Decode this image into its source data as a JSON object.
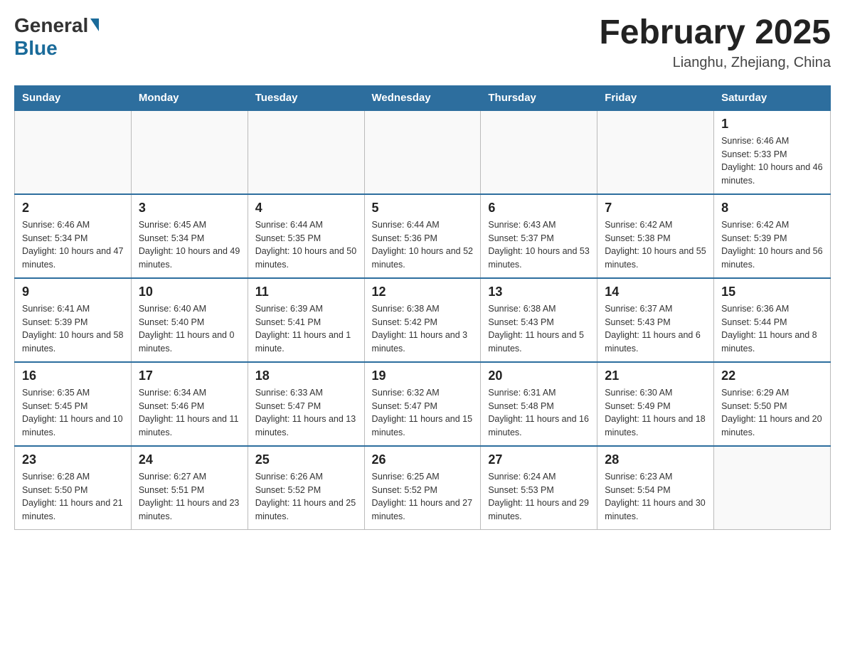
{
  "logo": {
    "general": "General",
    "blue": "Blue"
  },
  "title": "February 2025",
  "location": "Lianghu, Zhejiang, China",
  "days_of_week": [
    "Sunday",
    "Monday",
    "Tuesday",
    "Wednesday",
    "Thursday",
    "Friday",
    "Saturday"
  ],
  "weeks": [
    [
      {
        "day": "",
        "info": ""
      },
      {
        "day": "",
        "info": ""
      },
      {
        "day": "",
        "info": ""
      },
      {
        "day": "",
        "info": ""
      },
      {
        "day": "",
        "info": ""
      },
      {
        "day": "",
        "info": ""
      },
      {
        "day": "1",
        "info": "Sunrise: 6:46 AM\nSunset: 5:33 PM\nDaylight: 10 hours and 46 minutes."
      }
    ],
    [
      {
        "day": "2",
        "info": "Sunrise: 6:46 AM\nSunset: 5:34 PM\nDaylight: 10 hours and 47 minutes."
      },
      {
        "day": "3",
        "info": "Sunrise: 6:45 AM\nSunset: 5:34 PM\nDaylight: 10 hours and 49 minutes."
      },
      {
        "day": "4",
        "info": "Sunrise: 6:44 AM\nSunset: 5:35 PM\nDaylight: 10 hours and 50 minutes."
      },
      {
        "day": "5",
        "info": "Sunrise: 6:44 AM\nSunset: 5:36 PM\nDaylight: 10 hours and 52 minutes."
      },
      {
        "day": "6",
        "info": "Sunrise: 6:43 AM\nSunset: 5:37 PM\nDaylight: 10 hours and 53 minutes."
      },
      {
        "day": "7",
        "info": "Sunrise: 6:42 AM\nSunset: 5:38 PM\nDaylight: 10 hours and 55 minutes."
      },
      {
        "day": "8",
        "info": "Sunrise: 6:42 AM\nSunset: 5:39 PM\nDaylight: 10 hours and 56 minutes."
      }
    ],
    [
      {
        "day": "9",
        "info": "Sunrise: 6:41 AM\nSunset: 5:39 PM\nDaylight: 10 hours and 58 minutes."
      },
      {
        "day": "10",
        "info": "Sunrise: 6:40 AM\nSunset: 5:40 PM\nDaylight: 11 hours and 0 minutes."
      },
      {
        "day": "11",
        "info": "Sunrise: 6:39 AM\nSunset: 5:41 PM\nDaylight: 11 hours and 1 minute."
      },
      {
        "day": "12",
        "info": "Sunrise: 6:38 AM\nSunset: 5:42 PM\nDaylight: 11 hours and 3 minutes."
      },
      {
        "day": "13",
        "info": "Sunrise: 6:38 AM\nSunset: 5:43 PM\nDaylight: 11 hours and 5 minutes."
      },
      {
        "day": "14",
        "info": "Sunrise: 6:37 AM\nSunset: 5:43 PM\nDaylight: 11 hours and 6 minutes."
      },
      {
        "day": "15",
        "info": "Sunrise: 6:36 AM\nSunset: 5:44 PM\nDaylight: 11 hours and 8 minutes."
      }
    ],
    [
      {
        "day": "16",
        "info": "Sunrise: 6:35 AM\nSunset: 5:45 PM\nDaylight: 11 hours and 10 minutes."
      },
      {
        "day": "17",
        "info": "Sunrise: 6:34 AM\nSunset: 5:46 PM\nDaylight: 11 hours and 11 minutes."
      },
      {
        "day": "18",
        "info": "Sunrise: 6:33 AM\nSunset: 5:47 PM\nDaylight: 11 hours and 13 minutes."
      },
      {
        "day": "19",
        "info": "Sunrise: 6:32 AM\nSunset: 5:47 PM\nDaylight: 11 hours and 15 minutes."
      },
      {
        "day": "20",
        "info": "Sunrise: 6:31 AM\nSunset: 5:48 PM\nDaylight: 11 hours and 16 minutes."
      },
      {
        "day": "21",
        "info": "Sunrise: 6:30 AM\nSunset: 5:49 PM\nDaylight: 11 hours and 18 minutes."
      },
      {
        "day": "22",
        "info": "Sunrise: 6:29 AM\nSunset: 5:50 PM\nDaylight: 11 hours and 20 minutes."
      }
    ],
    [
      {
        "day": "23",
        "info": "Sunrise: 6:28 AM\nSunset: 5:50 PM\nDaylight: 11 hours and 21 minutes."
      },
      {
        "day": "24",
        "info": "Sunrise: 6:27 AM\nSunset: 5:51 PM\nDaylight: 11 hours and 23 minutes."
      },
      {
        "day": "25",
        "info": "Sunrise: 6:26 AM\nSunset: 5:52 PM\nDaylight: 11 hours and 25 minutes."
      },
      {
        "day": "26",
        "info": "Sunrise: 6:25 AM\nSunset: 5:52 PM\nDaylight: 11 hours and 27 minutes."
      },
      {
        "day": "27",
        "info": "Sunrise: 6:24 AM\nSunset: 5:53 PM\nDaylight: 11 hours and 29 minutes."
      },
      {
        "day": "28",
        "info": "Sunrise: 6:23 AM\nSunset: 5:54 PM\nDaylight: 11 hours and 30 minutes."
      },
      {
        "day": "",
        "info": ""
      }
    ]
  ]
}
